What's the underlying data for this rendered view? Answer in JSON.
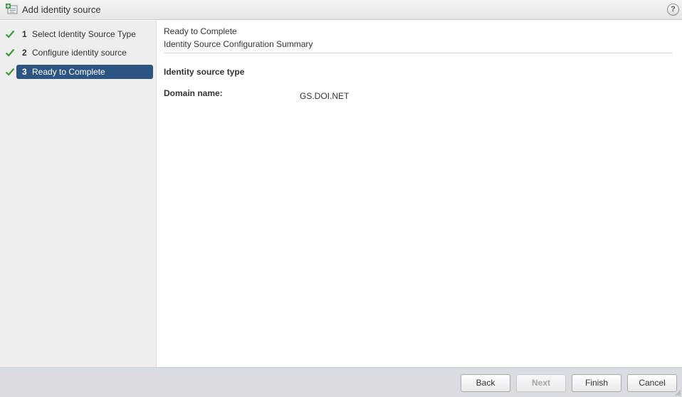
{
  "window": {
    "title": "Add identity source",
    "title_icon": "add-identity-source-icon",
    "help_label": "?"
  },
  "steps": [
    {
      "number": "1",
      "label": "Select Identity Source Type",
      "completed": true,
      "active": false
    },
    {
      "number": "2",
      "label": "Configure identity source",
      "completed": true,
      "active": false
    },
    {
      "number": "3",
      "label": "Ready to Complete",
      "completed": true,
      "active": true
    }
  ],
  "content": {
    "title": "Ready to Complete",
    "subtitle": "Identity Source Configuration Summary",
    "fields": [
      {
        "label": "Identity source type",
        "value": ""
      },
      {
        "label": "Domain name:",
        "value": "GS.DOI.NET"
      }
    ]
  },
  "footer": {
    "back_label": "Back",
    "next_label": "Next",
    "finish_label": "Finish",
    "cancel_label": "Cancel"
  },
  "colors": {
    "active_step": "#2d5583",
    "check": "#3a9a3a",
    "footer_bg": "#d9dde2"
  }
}
